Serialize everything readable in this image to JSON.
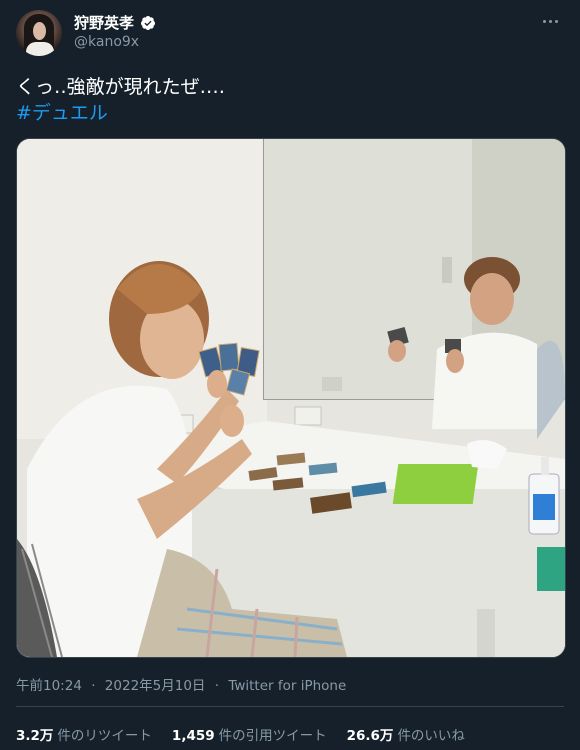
{
  "author": {
    "display_name": "狩野英孝",
    "handle": "@kano9x"
  },
  "tweet": {
    "text": "くっ‥強敵が現れたぜ‥‥",
    "hashtag": "#デュエル"
  },
  "meta": {
    "time": "午前10:24",
    "date": "2022年5月10日",
    "source": "Twitter for iPhone",
    "separator": "·"
  },
  "stats": {
    "retweets_num": "3.2万",
    "retweets_label": "件のリツイート",
    "quotes_num": "1,459",
    "quotes_label": "件の引用ツイート",
    "likes_num": "26.6万",
    "likes_label": "件のいいね"
  },
  "colors": {
    "background": "#15202b",
    "accent": "#1d9bf0",
    "secondary_text": "#8899a6",
    "border": "#38444d"
  },
  "icons": {
    "verified": "verified-badge-icon",
    "more": "more-options-icon"
  }
}
